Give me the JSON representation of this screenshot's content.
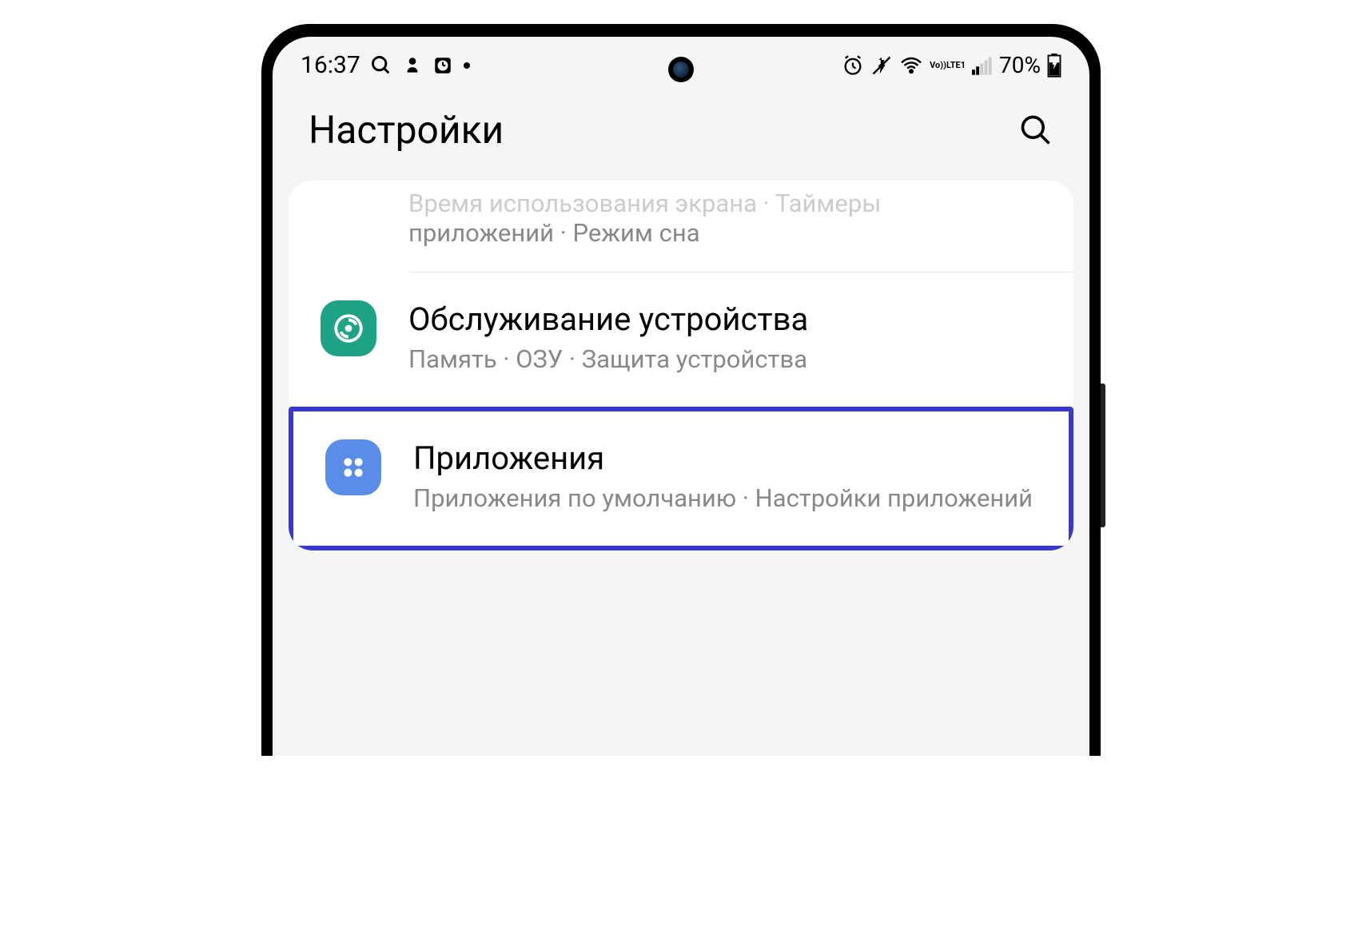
{
  "statusBar": {
    "time": "16:37",
    "batteryPercent": "70%"
  },
  "header": {
    "title": "Настройки"
  },
  "partialItem": {
    "fadedLine": "Время использования экрана · Таймеры",
    "line2": "приложений · Режим сна"
  },
  "items": [
    {
      "title": "Обслуживание устройства",
      "subtitle": "Память · ОЗУ · Защита устройства"
    },
    {
      "title": "Приложения",
      "subtitle": "Приложения по умолчанию · Настройки приложений"
    }
  ]
}
